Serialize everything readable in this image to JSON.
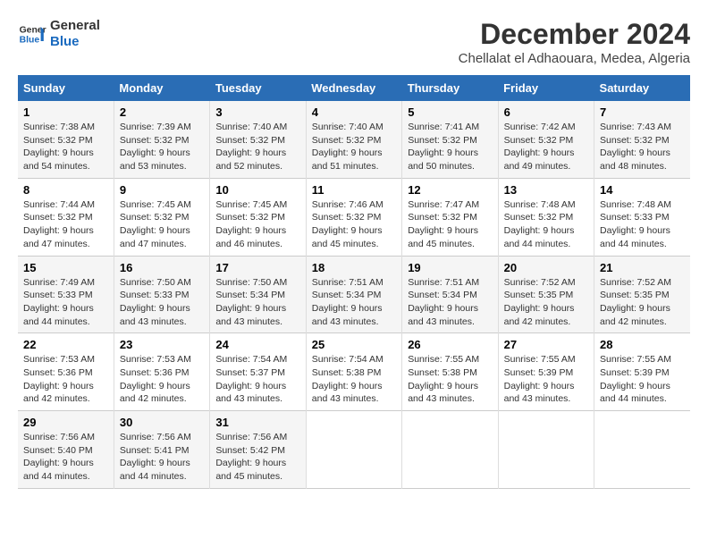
{
  "header": {
    "logo_line1": "General",
    "logo_line2": "Blue",
    "month_title": "December 2024",
    "location": "Chellalat el Adhaouara, Medea, Algeria"
  },
  "weekdays": [
    "Sunday",
    "Monday",
    "Tuesday",
    "Wednesday",
    "Thursday",
    "Friday",
    "Saturday"
  ],
  "weeks": [
    [
      {
        "day": "1",
        "info": "Sunrise: 7:38 AM\nSunset: 5:32 PM\nDaylight: 9 hours\nand 54 minutes."
      },
      {
        "day": "2",
        "info": "Sunrise: 7:39 AM\nSunset: 5:32 PM\nDaylight: 9 hours\nand 53 minutes."
      },
      {
        "day": "3",
        "info": "Sunrise: 7:40 AM\nSunset: 5:32 PM\nDaylight: 9 hours\nand 52 minutes."
      },
      {
        "day": "4",
        "info": "Sunrise: 7:40 AM\nSunset: 5:32 PM\nDaylight: 9 hours\nand 51 minutes."
      },
      {
        "day": "5",
        "info": "Sunrise: 7:41 AM\nSunset: 5:32 PM\nDaylight: 9 hours\nand 50 minutes."
      },
      {
        "day": "6",
        "info": "Sunrise: 7:42 AM\nSunset: 5:32 PM\nDaylight: 9 hours\nand 49 minutes."
      },
      {
        "day": "7",
        "info": "Sunrise: 7:43 AM\nSunset: 5:32 PM\nDaylight: 9 hours\nand 48 minutes."
      }
    ],
    [
      {
        "day": "8",
        "info": "Sunrise: 7:44 AM\nSunset: 5:32 PM\nDaylight: 9 hours\nand 47 minutes."
      },
      {
        "day": "9",
        "info": "Sunrise: 7:45 AM\nSunset: 5:32 PM\nDaylight: 9 hours\nand 47 minutes."
      },
      {
        "day": "10",
        "info": "Sunrise: 7:45 AM\nSunset: 5:32 PM\nDaylight: 9 hours\nand 46 minutes."
      },
      {
        "day": "11",
        "info": "Sunrise: 7:46 AM\nSunset: 5:32 PM\nDaylight: 9 hours\nand 45 minutes."
      },
      {
        "day": "12",
        "info": "Sunrise: 7:47 AM\nSunset: 5:32 PM\nDaylight: 9 hours\nand 45 minutes."
      },
      {
        "day": "13",
        "info": "Sunrise: 7:48 AM\nSunset: 5:32 PM\nDaylight: 9 hours\nand 44 minutes."
      },
      {
        "day": "14",
        "info": "Sunrise: 7:48 AM\nSunset: 5:33 PM\nDaylight: 9 hours\nand 44 minutes."
      }
    ],
    [
      {
        "day": "15",
        "info": "Sunrise: 7:49 AM\nSunset: 5:33 PM\nDaylight: 9 hours\nand 44 minutes."
      },
      {
        "day": "16",
        "info": "Sunrise: 7:50 AM\nSunset: 5:33 PM\nDaylight: 9 hours\nand 43 minutes."
      },
      {
        "day": "17",
        "info": "Sunrise: 7:50 AM\nSunset: 5:34 PM\nDaylight: 9 hours\nand 43 minutes."
      },
      {
        "day": "18",
        "info": "Sunrise: 7:51 AM\nSunset: 5:34 PM\nDaylight: 9 hours\nand 43 minutes."
      },
      {
        "day": "19",
        "info": "Sunrise: 7:51 AM\nSunset: 5:34 PM\nDaylight: 9 hours\nand 43 minutes."
      },
      {
        "day": "20",
        "info": "Sunrise: 7:52 AM\nSunset: 5:35 PM\nDaylight: 9 hours\nand 42 minutes."
      },
      {
        "day": "21",
        "info": "Sunrise: 7:52 AM\nSunset: 5:35 PM\nDaylight: 9 hours\nand 42 minutes."
      }
    ],
    [
      {
        "day": "22",
        "info": "Sunrise: 7:53 AM\nSunset: 5:36 PM\nDaylight: 9 hours\nand 42 minutes."
      },
      {
        "day": "23",
        "info": "Sunrise: 7:53 AM\nSunset: 5:36 PM\nDaylight: 9 hours\nand 42 minutes."
      },
      {
        "day": "24",
        "info": "Sunrise: 7:54 AM\nSunset: 5:37 PM\nDaylight: 9 hours\nand 43 minutes."
      },
      {
        "day": "25",
        "info": "Sunrise: 7:54 AM\nSunset: 5:38 PM\nDaylight: 9 hours\nand 43 minutes."
      },
      {
        "day": "26",
        "info": "Sunrise: 7:55 AM\nSunset: 5:38 PM\nDaylight: 9 hours\nand 43 minutes."
      },
      {
        "day": "27",
        "info": "Sunrise: 7:55 AM\nSunset: 5:39 PM\nDaylight: 9 hours\nand 43 minutes."
      },
      {
        "day": "28",
        "info": "Sunrise: 7:55 AM\nSunset: 5:39 PM\nDaylight: 9 hours\nand 44 minutes."
      }
    ],
    [
      {
        "day": "29",
        "info": "Sunrise: 7:56 AM\nSunset: 5:40 PM\nDaylight: 9 hours\nand 44 minutes."
      },
      {
        "day": "30",
        "info": "Sunrise: 7:56 AM\nSunset: 5:41 PM\nDaylight: 9 hours\nand 44 minutes."
      },
      {
        "day": "31",
        "info": "Sunrise: 7:56 AM\nSunset: 5:42 PM\nDaylight: 9 hours\nand 45 minutes."
      },
      null,
      null,
      null,
      null
    ]
  ]
}
